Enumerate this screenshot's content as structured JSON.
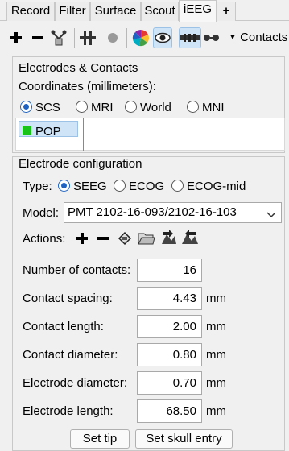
{
  "tabs": [
    {
      "label": "Record"
    },
    {
      "label": "Filter"
    },
    {
      "label": "Surface"
    },
    {
      "label": "Scout"
    },
    {
      "label": "iEEG"
    },
    {
      "label": "+"
    }
  ],
  "toolbar": {
    "contacts_label": "Contacts",
    "icons": [
      "add-icon",
      "remove-icon",
      "tree-icon",
      "cross-icon",
      "dot-icon",
      "colorwheel-icon",
      "eye-icon",
      "electrode-icon",
      "contacts-icon",
      "dropdown-icon"
    ]
  },
  "electrodes_panel": {
    "title": "Electrodes & Contacts",
    "coords_label": "Coordinates (millimeters):",
    "coords_options": [
      "SCS",
      "MRI",
      "World",
      "MNI"
    ],
    "coords_selected": "SCS",
    "list_items": [
      {
        "label": "POP",
        "color": "#18c218"
      }
    ]
  },
  "config_panel": {
    "title": "Electrode configuration",
    "type_label": "Type:",
    "type_options": [
      "SEEG",
      "ECOG",
      "ECOG-mid"
    ],
    "type_selected": "SEEG",
    "model_label": "Model:",
    "model_value": "PMT 2102-16-093/2102-16-103",
    "actions_label": "Actions:",
    "action_icons": [
      "add-icon",
      "remove-icon",
      "save-icon",
      "open-folder-icon",
      "import-icon",
      "export-icon"
    ],
    "fields": [
      {
        "label": "Number of contacts:",
        "value": "16",
        "unit": ""
      },
      {
        "label": "Contact spacing:",
        "value": "4.43",
        "unit": "mm"
      },
      {
        "label": "Contact length:",
        "value": "2.00",
        "unit": "mm"
      },
      {
        "label": "Contact diameter:",
        "value": "0.80",
        "unit": "mm"
      },
      {
        "label": "Electrode diameter:",
        "value": "0.70",
        "unit": "mm"
      },
      {
        "label": "Electrode length:",
        "value": "68.50",
        "unit": "mm"
      }
    ],
    "set_tip_label": "Set tip",
    "set_skull_label": "Set skull entry"
  }
}
